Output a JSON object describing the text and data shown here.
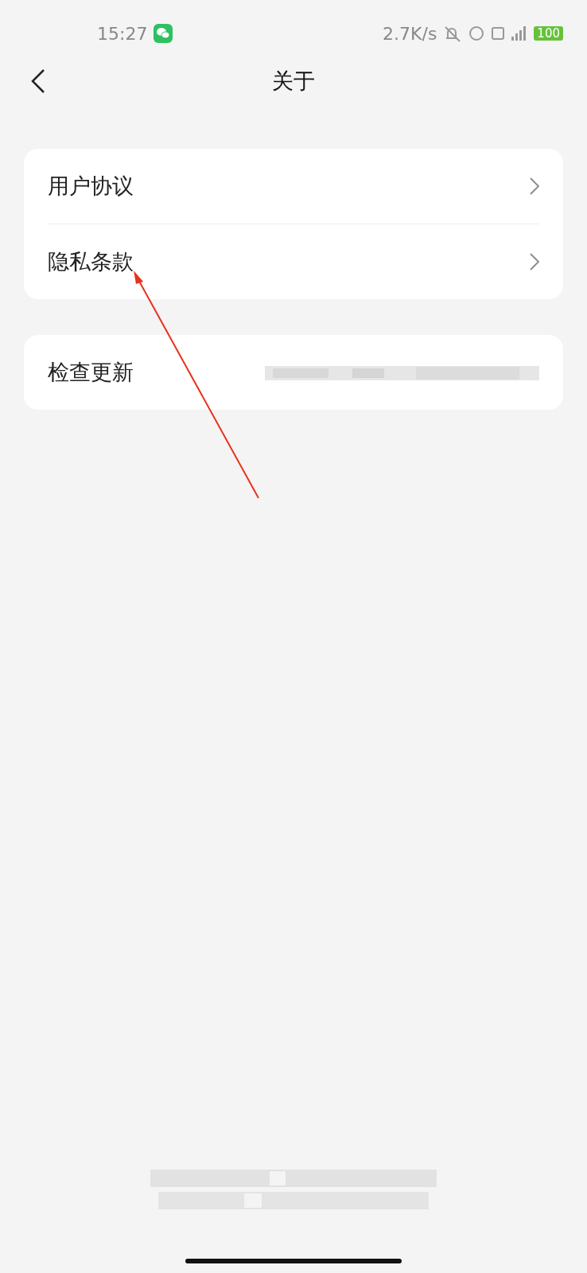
{
  "status_bar": {
    "time": "15:27",
    "speed": "2.7K/s",
    "battery": "100"
  },
  "header": {
    "title": "关于"
  },
  "groups": [
    {
      "items": [
        {
          "label": "用户协议",
          "kind": "link"
        },
        {
          "label": "隐私条款",
          "kind": "link"
        }
      ]
    },
    {
      "items": [
        {
          "label": "检查更新",
          "kind": "blurred"
        }
      ]
    }
  ]
}
